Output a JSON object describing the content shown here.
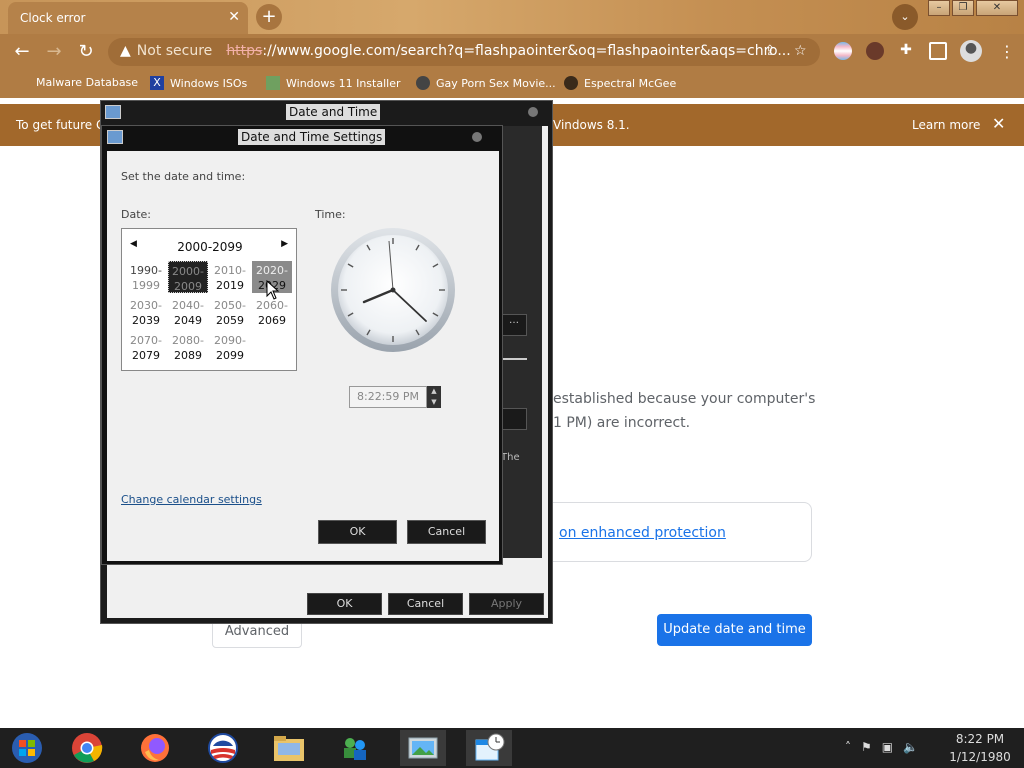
{
  "browser": {
    "tab_title": "Clock error",
    "tab_close": "✕",
    "new_tab": "+",
    "security_label": "Not secure",
    "url_scheme": "https",
    "url_rest": "://www.google.com/search?q=flashpaointer&oq=flashpaointer&aqs=chro...",
    "window_controls": [
      "–",
      "❐",
      "✕"
    ]
  },
  "bookmarks": [
    {
      "label": "Malware Database",
      "icon": "malware-icon",
      "color": "#8a6a3a"
    },
    {
      "label": "Windows ISOs",
      "icon": "x-logo-icon",
      "color": "#1f3fa0"
    },
    {
      "label": "Windows 11 Installer",
      "icon": "image-icon",
      "color": "#6fa060"
    },
    {
      "label": "Gay Porn Sex Movie...",
      "icon": "globe-icon",
      "color": "#444444"
    },
    {
      "label": "Espectral McGee",
      "icon": "avatar-icon",
      "color": "#3a2a1a"
    }
  ],
  "infobar": {
    "text_left": "To get future G",
    "text_right": "Vindows 8.1.",
    "learn_more": "Learn more",
    "close": "✕"
  },
  "page": {
    "text_line1": "established because your computer's",
    "text_line2": "1 PM) are incorrect.",
    "enhanced_link": "on enhanced protection",
    "update_button": "Update date and time",
    "advanced_button": "Advanced"
  },
  "dialog_outer": {
    "title": "Date and Time",
    "ok": "OK",
    "cancel": "Cancel",
    "apply": "Apply"
  },
  "dialog_inner": {
    "title": "Date and Time Settings",
    "set_label": "Set the date and time:",
    "date_label": "Date:",
    "time_label": "Time:",
    "calendar_header": "2000-2099",
    "decades": [
      {
        "a": "1990-",
        "b": "1999",
        "state": "dim"
      },
      {
        "a": "2000-",
        "b": "2009",
        "state": "selected"
      },
      {
        "a": "2010-",
        "b": "2019",
        "state": "normal"
      },
      {
        "a": "2020-",
        "b": "2029",
        "state": "hover"
      },
      {
        "a": "2030-",
        "b": "2039",
        "state": "normal"
      },
      {
        "a": "2040-",
        "b": "2049",
        "state": "normal"
      },
      {
        "a": "2050-",
        "b": "2059",
        "state": "normal"
      },
      {
        "a": "2060-",
        "b": "2069",
        "state": "normal"
      },
      {
        "a": "2070-",
        "b": "2079",
        "state": "normal"
      },
      {
        "a": "2080-",
        "b": "2089",
        "state": "normal"
      },
      {
        "a": "2090-",
        "b": "2099",
        "state": "normal"
      }
    ],
    "time_value": "8:22:59 PM",
    "change_calendar_link": "Change calendar settings",
    "ok": "OK",
    "cancel": "Cancel"
  },
  "taskbar": {
    "apps": [
      "windows-start-icon",
      "chrome-icon",
      "firefox-icon",
      "obama-logo-icon",
      "file-explorer-icon",
      "network-people-icon",
      "image-viewer-icon",
      "calendar-clock-icon"
    ],
    "time": "8:22 PM",
    "date": "1/12/1980"
  }
}
